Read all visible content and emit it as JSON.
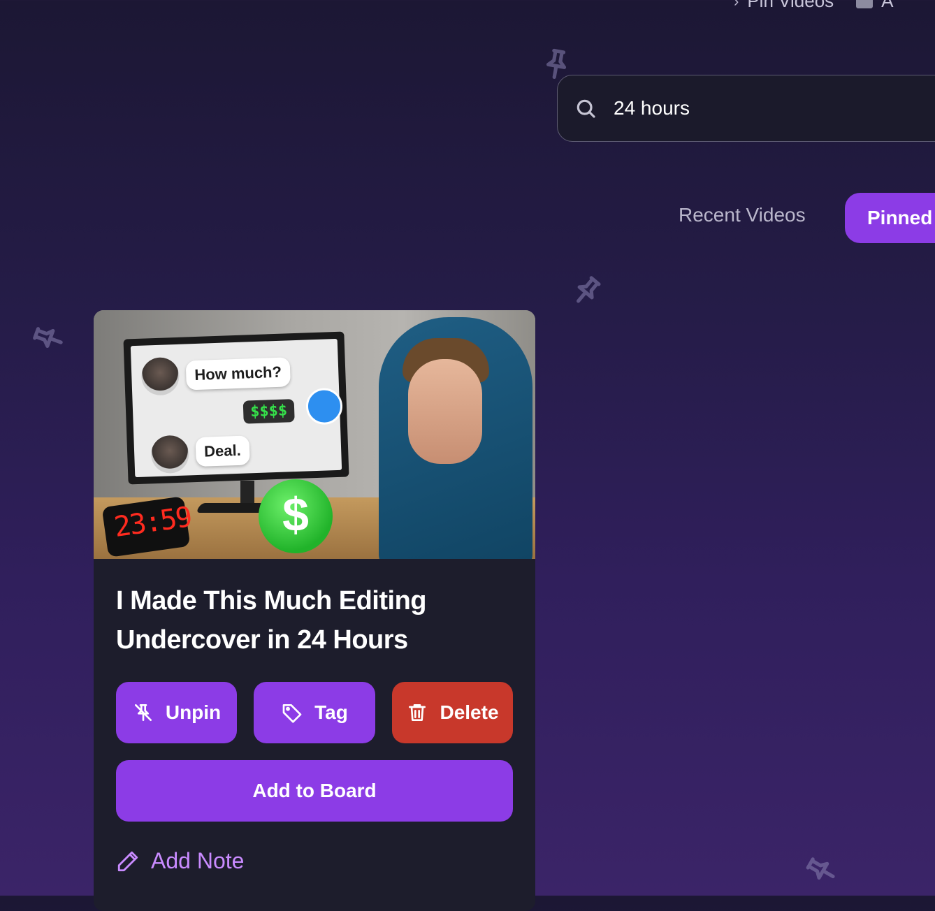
{
  "nav": {
    "item_label": "Pin Videos",
    "item_next": "A"
  },
  "search": {
    "value": "24 hours",
    "placeholder": ""
  },
  "tabs": {
    "recent_label": "Recent Videos",
    "pinned_label": "Pinned"
  },
  "video": {
    "title": "I Made This Much Editing Undercover in 24 Hours",
    "thumbnail": {
      "bubble_1": "How much?",
      "price_tag": "$$$$",
      "bubble_2": "Deal.",
      "clock_time": "23:59",
      "coin_symbol": "$"
    },
    "actions": {
      "unpin_label": "Unpin",
      "tag_label": "Tag",
      "delete_label": "Delete",
      "board_label": "Add to Board",
      "note_label": "Add Note"
    }
  },
  "colors": {
    "accent": "#8c3ce6",
    "danger": "#c8382b",
    "note_link": "#c98bff",
    "card_bg": "#1d1d2c"
  }
}
